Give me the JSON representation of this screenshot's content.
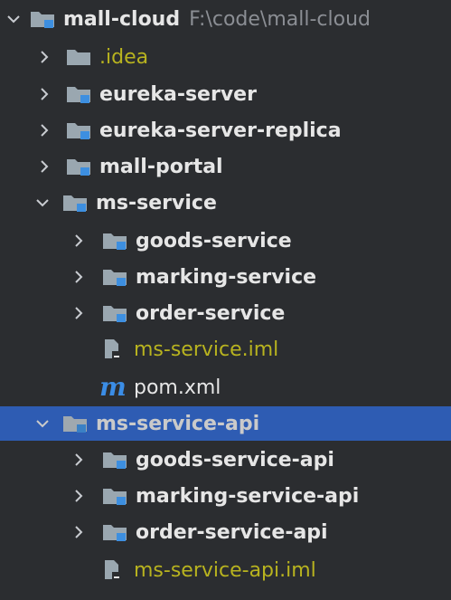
{
  "project": {
    "name": "mall-cloud",
    "path": "F:\\code\\mall-cloud"
  },
  "tree": {
    "idea": ".idea",
    "eureka_server": "eureka-server",
    "eureka_server_replica": "eureka-server-replica",
    "mall_portal": "mall-portal",
    "ms_service": "ms-service",
    "goods_service": "goods-service",
    "marking_service": "marking-service",
    "order_service": "order-service",
    "ms_service_iml": "ms-service.iml",
    "pom_xml": "pom.xml",
    "ms_service_api": "ms-service-api",
    "goods_service_api": "goods-service-api",
    "marking_service_api": "marking-service-api",
    "order_service_api": "order-service-api",
    "ms_service_api_iml": "ms-service-api.iml"
  },
  "icons": {
    "folder_color": "#9aa7b0",
    "module_badge_color": "#3d8fe0",
    "selected_row_color": "#2f65ca",
    "maven_icon": "m"
  }
}
